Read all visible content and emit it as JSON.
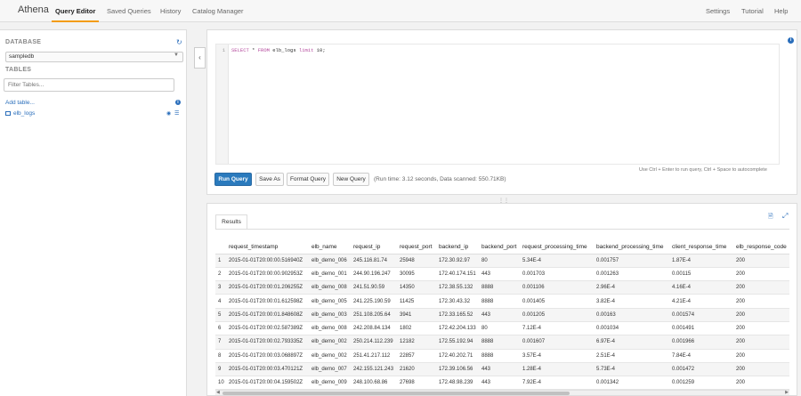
{
  "app": {
    "brand": "Athena"
  },
  "nav": {
    "items": [
      "Query Editor",
      "Saved Queries",
      "History",
      "Catalog Manager"
    ],
    "right": [
      "Settings",
      "Tutorial",
      "Help"
    ]
  },
  "sidebar": {
    "database_label": "DATABASE",
    "database_value": "sampledb",
    "tables_label": "TABLES",
    "filter_placeholder": "Filter Tables...",
    "add_table": "Add table...",
    "tables": [
      "elb_logs"
    ]
  },
  "editor": {
    "line_number": "1",
    "query": {
      "kw1": "SELECT",
      "star": " * ",
      "kw2": "FROM",
      "table": " elb_logs ",
      "kw3": "limit",
      "rest": " 10;"
    },
    "hint": "Use Ctrl + Enter to run query, Ctrl + Space to autocomplete",
    "buttons": {
      "run": "Run Query",
      "save_as": "Save As",
      "format": "Format Query",
      "new": "New Query"
    },
    "run_info": "(Run time: 3.12 seconds, Data scanned: 550.71KB)"
  },
  "results": {
    "tab_label": "Results",
    "columns": [
      "",
      "request_timestamp",
      "elb_name",
      "request_ip",
      "request_port",
      "backend_ip",
      "backend_port",
      "request_processing_time",
      "backend_processing_time",
      "client_response_time",
      "elb_response_code"
    ],
    "rows": [
      [
        "1",
        "2015-01-01T20:00:00.516940Z",
        "elb_demo_006",
        "245.116.81.74",
        "25948",
        "172.30.92.97",
        "80",
        "5.34E-4",
        "0.001757",
        "1.87E-4",
        "200"
      ],
      [
        "2",
        "2015-01-01T20:00:00.902953Z",
        "elb_demo_001",
        "244.90.196.247",
        "30095",
        "172.40.174.151",
        "443",
        "0.001703",
        "0.001263",
        "0.00115",
        "200"
      ],
      [
        "3",
        "2015-01-01T20:00:01.206255Z",
        "elb_demo_008",
        "241.51.90.59",
        "14350",
        "172.38.55.132",
        "8888",
        "0.001106",
        "2.96E-4",
        "4.16E-4",
        "200"
      ],
      [
        "4",
        "2015-01-01T20:00:01.612598Z",
        "elb_demo_005",
        "241.225.190.59",
        "11425",
        "172.30.43.32",
        "8888",
        "0.001405",
        "3.82E-4",
        "4.21E-4",
        "200"
      ],
      [
        "5",
        "2015-01-01T20:00:01.848608Z",
        "elb_demo_003",
        "251.108.205.64",
        "3941",
        "172.33.165.52",
        "443",
        "0.001205",
        "0.00163",
        "0.001574",
        "200"
      ],
      [
        "6",
        "2015-01-01T20:00:02.587389Z",
        "elb_demo_008",
        "242.208.84.134",
        "1802",
        "172.42.204.133",
        "80",
        "7.12E-4",
        "0.001034",
        "0.001491",
        "200"
      ],
      [
        "7",
        "2015-01-01T20:00:02.793335Z",
        "elb_demo_002",
        "250.214.112.239",
        "12182",
        "172.55.192.94",
        "8888",
        "0.001607",
        "6.97E-4",
        "0.001966",
        "200"
      ],
      [
        "8",
        "2015-01-01T20:00:03.068897Z",
        "elb_demo_002",
        "251.41.217.112",
        "22857",
        "172.40.202.71",
        "8888",
        "3.57E-4",
        "2.51E-4",
        "7.84E-4",
        "200"
      ],
      [
        "9",
        "2015-01-01T20:00:03.470121Z",
        "elb_demo_007",
        "242.155.121.243",
        "21620",
        "172.39.106.56",
        "443",
        "1.28E-4",
        "5.73E-4",
        "0.001472",
        "200"
      ],
      [
        "10",
        "2015-01-01T20:00:04.159502Z",
        "elb_demo_009",
        "248.100.68.86",
        "27698",
        "172.48.98.239",
        "443",
        "7.92E-4",
        "0.001342",
        "0.001259",
        "200"
      ]
    ]
  }
}
